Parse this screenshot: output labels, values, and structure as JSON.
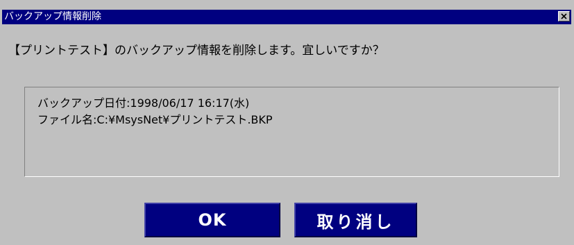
{
  "window": {
    "title": "バックアップ情報削除"
  },
  "message": "【プリントテスト】のバックアップ情報を削除します。宜しいですか？",
  "info": {
    "backup_date_line": "バックアップ日付:1998/06/17 16:17(水)",
    "file_name_line": "ファイル名:C:¥MsysNet¥プリントテスト.BKP"
  },
  "buttons": {
    "ok_label": "OK",
    "cancel_label": "取り消し"
  },
  "colors": {
    "titlebar": "#000080",
    "window_background": "#c0c0c0",
    "button_background": "#000080",
    "button_text": "#ffffff"
  },
  "icons": {
    "close": "close-icon"
  }
}
